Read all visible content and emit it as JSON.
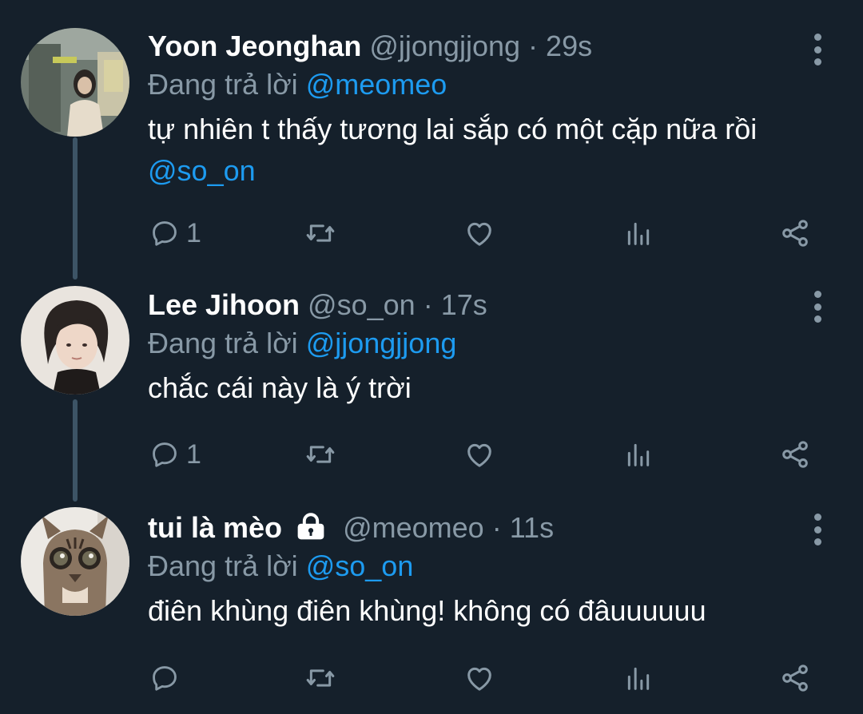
{
  "colors": {
    "background": "#15202b",
    "secondary_text": "#8899a6",
    "link": "#1d9bf0",
    "thread_line": "#3d5466"
  },
  "tweets": [
    {
      "display_name": "Yoon Jeonghan",
      "handle": "@jjongjjong",
      "separator": "·",
      "time": "29s",
      "protected": false,
      "reply_prefix": "Đang trả lời",
      "reply_to": "@meomeo",
      "text": "tự nhiên t thấy tương lai sắp có một cặp nữa rồi",
      "text_mention": "@so_on",
      "reply_count": "1",
      "icons": [
        "reply-icon",
        "retweet-icon",
        "like-icon",
        "analytics-icon",
        "share-icon"
      ]
    },
    {
      "display_name": "Lee Jihoon",
      "handle": "@so_on",
      "separator": "·",
      "time": "17s",
      "protected": false,
      "reply_prefix": "Đang trả lời",
      "reply_to": "@jjongjjong",
      "text": "chắc cái này là ý trời",
      "text_mention": "",
      "reply_count": "1",
      "icons": [
        "reply-icon",
        "retweet-icon",
        "like-icon",
        "analytics-icon",
        "share-icon"
      ]
    },
    {
      "display_name": "tui là mèo",
      "handle": "@meomeo",
      "separator": "·",
      "time": "11s",
      "protected": true,
      "reply_prefix": "Đang trả lời",
      "reply_to": "@so_on",
      "text": "điên khùng điên khùng! không có đâuuuuuu",
      "text_mention": "",
      "reply_count": "",
      "icons": [
        "reply-icon",
        "retweet-icon",
        "like-icon",
        "analytics-icon",
        "share-icon"
      ]
    }
  ]
}
